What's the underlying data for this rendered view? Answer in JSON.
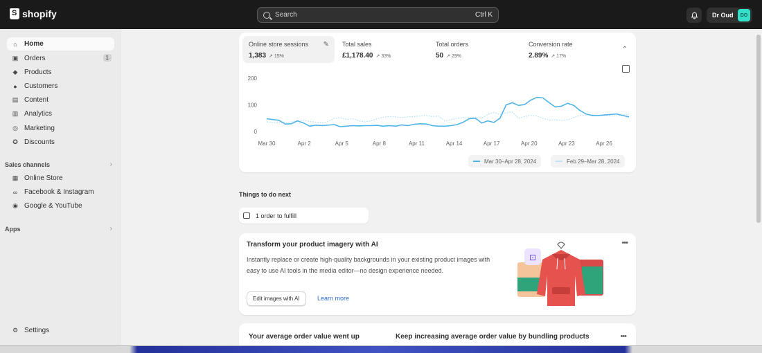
{
  "brand": {
    "name": "shopify"
  },
  "search": {
    "placeholder": "Search",
    "shortcut": "Ctrl K"
  },
  "user": {
    "name": "Dr Oud",
    "initials": "DO"
  },
  "sidebar": {
    "items": [
      {
        "label": "Home",
        "icon": "home-icon",
        "active": true
      },
      {
        "label": "Orders",
        "icon": "inbox-icon",
        "badge": "1"
      },
      {
        "label": "Products",
        "icon": "tag-icon"
      },
      {
        "label": "Customers",
        "icon": "person-icon"
      },
      {
        "label": "Content",
        "icon": "content-icon"
      },
      {
        "label": "Analytics",
        "icon": "bar-chart-icon"
      },
      {
        "label": "Marketing",
        "icon": "target-icon"
      },
      {
        "label": "Discounts",
        "icon": "discount-icon"
      }
    ],
    "sales_channels_label": "Sales channels",
    "channels": [
      {
        "label": "Online Store",
        "icon": "store-icon"
      },
      {
        "label": "Facebook & Instagram",
        "icon": "meta-icon"
      },
      {
        "label": "Google & YouTube",
        "icon": "google-icon"
      }
    ],
    "apps_label": "Apps",
    "settings_label": "Settings"
  },
  "metrics": [
    {
      "label": "Online store sessions",
      "value": "1,383",
      "delta": "15%"
    },
    {
      "label": "Total sales",
      "value": "£1,178.40",
      "delta": "33%"
    },
    {
      "label": "Total orders",
      "value": "50",
      "delta": "29%"
    },
    {
      "label": "Conversion rate",
      "value": "2.89%",
      "delta": "17%"
    }
  ],
  "chart_data": {
    "type": "line",
    "y_ticks": [
      "200",
      "100",
      "0"
    ],
    "ylim": [
      0,
      200
    ],
    "x_ticks": [
      "Mar 30",
      "Apr 2",
      "Apr 5",
      "Apr 8",
      "Apr 11",
      "Apr 14",
      "Apr 17",
      "Apr 20",
      "Apr 23",
      "Apr 26"
    ],
    "series": [
      {
        "name": "Mar 30–Apr 28, 2024",
        "color": "#4fb3e8",
        "style": "solid",
        "values": [
          48,
          45,
          42,
          28,
          29,
          40,
          32,
          20,
          24,
          22,
          24,
          26,
          18,
          20,
          22,
          21,
          22,
          22,
          23,
          20,
          22,
          20,
          25,
          22,
          27,
          29,
          28,
          22,
          20,
          20,
          22,
          26,
          35,
          48,
          50,
          32,
          40,
          34,
          50,
          100,
          108,
          98,
          101,
          118,
          128,
          126,
          108,
          92,
          95,
          106,
          98,
          79,
          66,
          60,
          60,
          62,
          64,
          66,
          60,
          55
        ]
      },
      {
        "name": "Feb 29–Mar 28, 2024",
        "color": "#bfe2f5",
        "style": "dashed",
        "values": [
          36,
          34,
          33,
          34,
          36,
          40,
          42,
          38,
          35,
          32,
          38,
          50,
          52,
          45,
          48,
          40,
          36,
          40,
          48,
          54,
          56,
          55,
          52,
          55,
          56,
          58,
          60,
          56,
          58,
          40,
          44,
          50,
          52,
          52,
          54,
          50,
          64,
          72,
          64,
          70,
          73,
          50,
          56,
          60,
          58,
          50,
          42,
          44,
          42,
          44,
          52,
          60,
          62,
          64,
          60,
          60,
          58,
          58,
          62,
          66
        ]
      }
    ]
  },
  "todo": {
    "title": "Things to do next",
    "item": "1 order to fulfill"
  },
  "ai_card": {
    "title": "Transform your product imagery with AI",
    "description": "Instantly replace or create high-quality backgrounds in your existing product images with easy to use AI tools in the media editor—no design experience needed.",
    "button": "Edit images with AI",
    "link": "Learn more"
  },
  "aov_card": {
    "left": "Your average order value went up",
    "right": "Keep increasing average order value by bundling products"
  },
  "colors": {
    "topbar": "#1a1a1a",
    "accent": "#35e0c8",
    "link": "#2c6ecb",
    "series1": "#4fb3e8",
    "series2": "#bfe2f5"
  }
}
